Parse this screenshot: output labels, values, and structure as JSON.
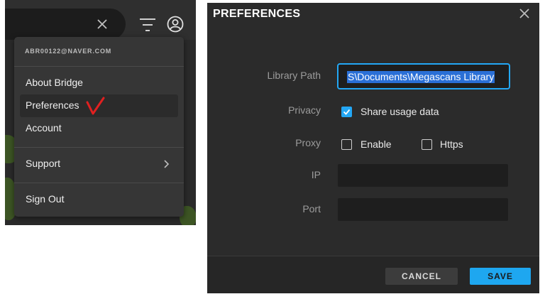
{
  "bridge": {
    "user_email": "ABR00122@NAVER.COM",
    "menu": [
      {
        "label": "About Bridge"
      },
      {
        "label": "Preferences"
      },
      {
        "label": "Account"
      },
      {
        "label": "Support"
      },
      {
        "label": "Sign Out"
      }
    ],
    "icons": {
      "search_clear": "close-icon",
      "filter": "filter-icon",
      "user": "user-circle-icon",
      "submenu": "chevron-right-icon",
      "annotation": "red-check-mark"
    }
  },
  "preferences": {
    "title": "PREFERENCES",
    "library_path_label": "Library Path",
    "library_path_value": "S\\Documents\\Megascans Library",
    "privacy_label": "Privacy",
    "share_usage_label": "Share usage data",
    "share_usage_checked": true,
    "proxy_label": "Proxy",
    "enable_label": "Enable",
    "enable_checked": false,
    "https_label": "Https",
    "https_checked": false,
    "ip_label": "IP",
    "port_label": "Port",
    "cancel_label": "CANCEL",
    "save_label": "SAVE"
  },
  "colors": {
    "accent": "#23a7f5",
    "annotation": "#e02020"
  }
}
